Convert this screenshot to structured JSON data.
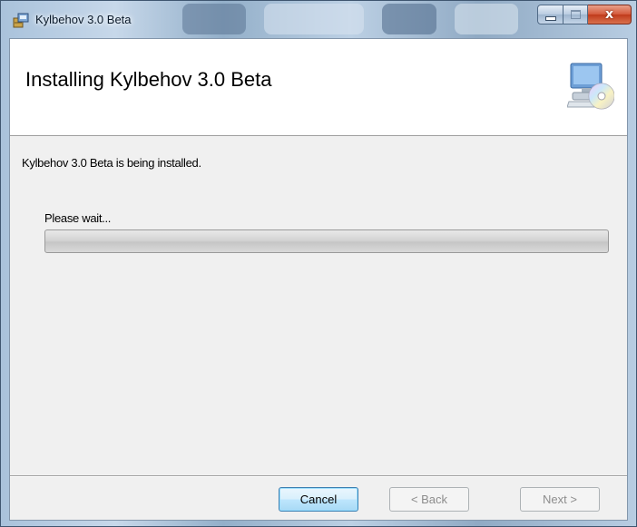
{
  "window": {
    "title": "Kylbehov 3.0 Beta",
    "close_glyph": "x"
  },
  "banner": {
    "title": "Installing Kylbehov 3.0 Beta"
  },
  "body": {
    "status": "Kylbehov 3.0 Beta is being installed.",
    "progress_label": "Please wait...",
    "progress_fraction": 0.0
  },
  "buttons": {
    "cancel": "Cancel",
    "back": "< Back",
    "next": "Next >"
  },
  "icons": {
    "app": "installer-package-icon",
    "banner": "computer-cd-icon"
  },
  "colors": {
    "client_bg": "#f0f0f0",
    "banner_bg": "#ffffff",
    "close_button": "#c8452a",
    "default_button_border": "#3c7fb1"
  }
}
